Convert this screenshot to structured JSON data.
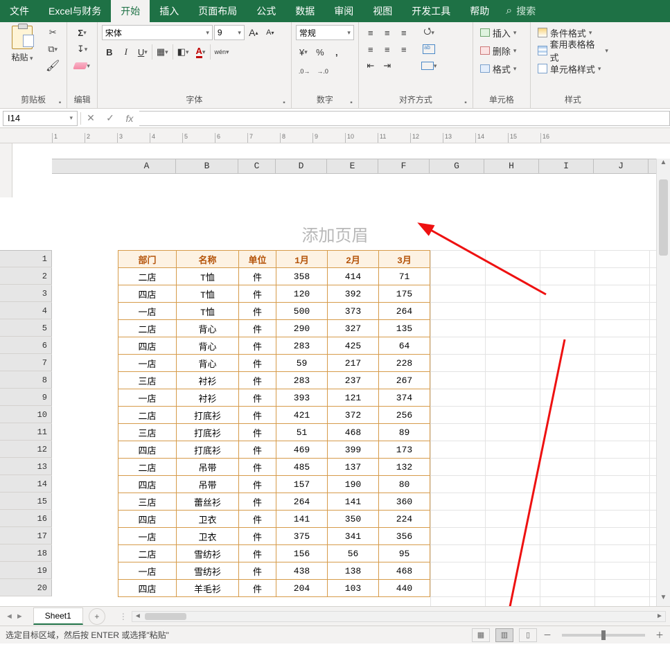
{
  "tabs": {
    "file": "文件",
    "addin": "Excel与财务",
    "home": "开始",
    "insert": "插入",
    "pagelayout": "页面布局",
    "formulas": "公式",
    "data": "数据",
    "review": "审阅",
    "view": "视图",
    "developer": "开发工具",
    "help": "帮助",
    "search": "搜索"
  },
  "ribbon": {
    "clipboard": {
      "label": "剪贴板",
      "paste": "粘贴"
    },
    "editing": {
      "label": "编辑"
    },
    "font": {
      "label": "字体",
      "name": "宋体",
      "size": "9"
    },
    "number": {
      "label": "数字",
      "format": "常规"
    },
    "alignment": {
      "label": "对齐方式"
    },
    "cells": {
      "label": "单元格",
      "insert": "插入",
      "delete": "删除",
      "format": "格式"
    },
    "styles": {
      "label": "样式",
      "cond": "条件格式",
      "table": "套用表格格式",
      "cell": "单元格样式"
    }
  },
  "namebox": "I14",
  "header_placeholder": "添加页眉",
  "h_ruler": [
    "1",
    "2",
    "3",
    "4",
    "5",
    "6",
    "7",
    "8",
    "9",
    "10",
    "11",
    "12",
    "13",
    "14",
    "15",
    "16"
  ],
  "columns": [
    "A",
    "B",
    "C",
    "D",
    "E",
    "F",
    "G",
    "H",
    "I",
    "J"
  ],
  "col_widths": {
    "A": 84,
    "B": 90,
    "C": 54,
    "D": 74,
    "E": 74,
    "F": 74,
    "G": 79,
    "H": 79,
    "I": 79,
    "J": 79
  },
  "row_numbers": [
    1,
    2,
    3,
    4,
    5,
    6,
    7,
    8,
    9,
    10,
    11,
    12,
    13,
    14,
    15,
    16,
    17,
    18,
    19,
    20
  ],
  "table": {
    "headers": [
      "部门",
      "名称",
      "单位",
      "1月",
      "2月",
      "3月"
    ],
    "rows": [
      [
        "二店",
        "T恤",
        "件",
        358,
        414,
        71
      ],
      [
        "四店",
        "T恤",
        "件",
        120,
        392,
        175
      ],
      [
        "一店",
        "T恤",
        "件",
        500,
        373,
        264
      ],
      [
        "二店",
        "背心",
        "件",
        290,
        327,
        135
      ],
      [
        "四店",
        "背心",
        "件",
        283,
        425,
        64
      ],
      [
        "一店",
        "背心",
        "件",
        59,
        217,
        228
      ],
      [
        "三店",
        "衬衫",
        "件",
        283,
        237,
        267
      ],
      [
        "一店",
        "衬衫",
        "件",
        393,
        121,
        374
      ],
      [
        "二店",
        "打底衫",
        "件",
        421,
        372,
        256
      ],
      [
        "三店",
        "打底衫",
        "件",
        51,
        468,
        89
      ],
      [
        "四店",
        "打底衫",
        "件",
        469,
        399,
        173
      ],
      [
        "二店",
        "吊带",
        "件",
        485,
        137,
        132
      ],
      [
        "四店",
        "吊带",
        "件",
        157,
        190,
        80
      ],
      [
        "三店",
        "蕾丝衫",
        "件",
        264,
        141,
        360
      ],
      [
        "四店",
        "卫衣",
        "件",
        141,
        350,
        224
      ],
      [
        "一店",
        "卫衣",
        "件",
        375,
        341,
        356
      ],
      [
        "二店",
        "雪纺衫",
        "件",
        156,
        56,
        95
      ],
      [
        "一店",
        "雪纺衫",
        "件",
        438,
        138,
        468
      ],
      [
        "四店",
        "羊毛衫",
        "件",
        204,
        103,
        440
      ]
    ]
  },
  "sheet_tabs": {
    "s1": "Sheet1"
  },
  "status_text": "选定目标区域，然后按 ENTER 或选择\"粘贴\""
}
